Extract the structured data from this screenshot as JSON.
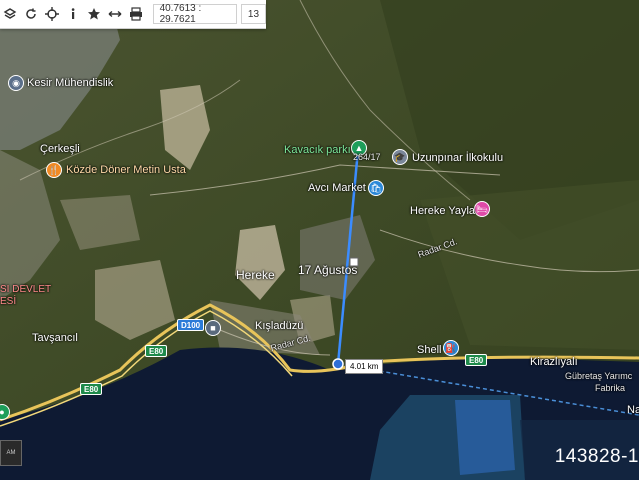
{
  "toolbar": {
    "buttons": [
      {
        "name": "layers-icon"
      },
      {
        "name": "refresh-icon"
      },
      {
        "name": "locate-icon"
      },
      {
        "name": "info-icon"
      },
      {
        "name": "star-icon"
      },
      {
        "name": "measure-icon"
      },
      {
        "name": "print-icon"
      }
    ],
    "coordinates": "40.7613 : 29.7621",
    "zoom": "13"
  },
  "labels": {
    "kesir": "Kesir Mühendislik",
    "cerkesli": "Çerkeşli",
    "kozde": "Közde Döner Metin Usta",
    "kavacik": "Kavacık parkı",
    "uzunpinar": "Uzunpınar İlkokulu",
    "avci": "Avcı Market",
    "hereke_yayla": "Hereke Yayla",
    "hereke": "Hereke",
    "agustos": "17 Ağustos",
    "kisladuzu": "Kışladüzü",
    "tavsancil": "Tavşancıl",
    "devlet1": "SI DEVLET",
    "devlet2": "ESİ",
    "shell": "Shell",
    "kirazliyali": "Kirazlıyalı",
    "gubretas1": "Gübretaş Yarımc",
    "gubretas2": "Fabrika",
    "na": "Na",
    "radar1": "Radar Cd.",
    "radar2": "Radar Cd.",
    "measure_start": "264/17",
    "corner": "AM"
  },
  "roads": {
    "d100": "D100",
    "e80a": "E80",
    "e80b": "E80",
    "e80c": "E80"
  },
  "measurement": {
    "distance": "4.01 km"
  },
  "watermark": "143828-1",
  "colors": {
    "route": "#3b8cff",
    "poi_green": "#1e9e5a",
    "poi_blue": "#2b88d8",
    "poi_pink": "#e04aa8",
    "poi_orange": "#f08a24",
    "sea": "#0e1a33"
  }
}
